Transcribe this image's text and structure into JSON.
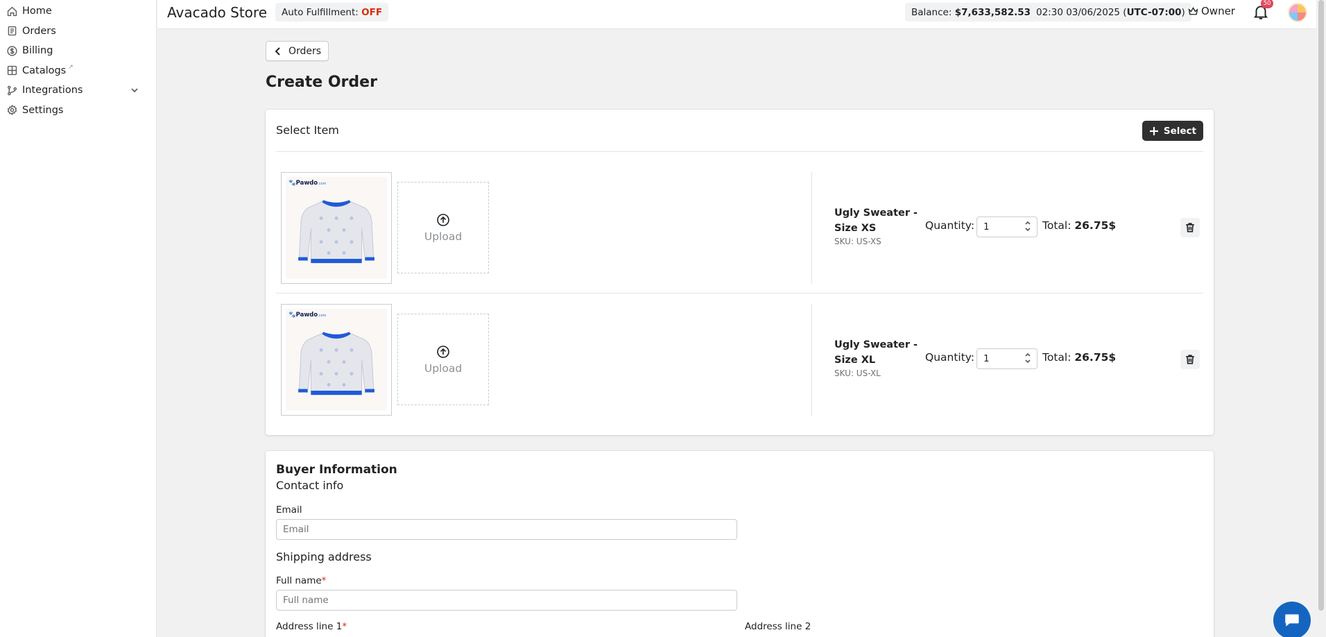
{
  "sidebar": {
    "items": [
      {
        "label": "Home",
        "icon": "home-icon"
      },
      {
        "label": "Orders",
        "icon": "orders-icon"
      },
      {
        "label": "Billing",
        "icon": "billing-icon"
      },
      {
        "label": "Catalogs",
        "icon": "catalogs-icon",
        "external": "↗"
      },
      {
        "label": "Integrations",
        "icon": "integrations-icon"
      },
      {
        "label": "Settings",
        "icon": "settings-icon"
      }
    ]
  },
  "header": {
    "store_name": "Avacado Store",
    "auto_fulfillment_label": "Auto Fulfillment:",
    "auto_fulfillment_value": "OFF",
    "balance_label": "Balance:",
    "balance_value": "$7,633,582.53",
    "time_value": "02:30 03/06/2025",
    "timezone": "UTC-07:00",
    "role": "Owner",
    "notification_count": "50"
  },
  "page": {
    "back_label": "Orders",
    "title": "Create Order"
  },
  "items_card": {
    "title": "Select Item",
    "select_label": "Select",
    "upload_label": "Upload",
    "quantity_label": "Quantity:",
    "total_label": "Total:",
    "brand": "Pawdo",
    "brand_suffix": ".com",
    "rows": [
      {
        "name": "Ugly Sweater - Size XS",
        "sku": "SKU: US-XS",
        "quantity": "1",
        "total": "26.75$"
      },
      {
        "name": "Ugly Sweater - Size XL",
        "sku": "SKU: US-XL",
        "quantity": "1",
        "total": "26.75$"
      }
    ]
  },
  "buyer": {
    "title": "Buyer Information",
    "contact_title": "Contact info",
    "email_label": "Email",
    "email_placeholder": "Email",
    "shipping_title": "Shipping address",
    "fullname_label": "Full name",
    "fullname_placeholder": "Full name",
    "address1_label": "Address line 1",
    "address2_label": "Address line 2",
    "required_mark": "*"
  },
  "colors": {
    "accent_dark": "#303030",
    "off_red": "#d72c0d",
    "chat_blue": "#1565c0",
    "sweater_blue": "#1f5bd6"
  }
}
